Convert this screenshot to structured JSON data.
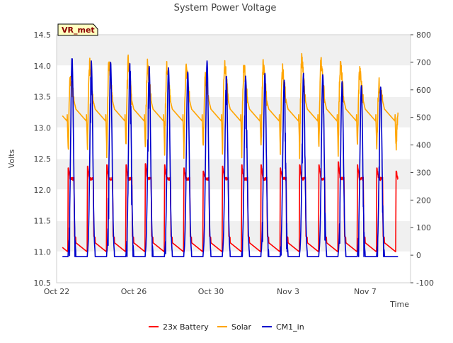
{
  "chart_data": {
    "type": "line",
    "title": "System Power Voltage",
    "xlabel": "Time",
    "ylabel": "Volts",
    "badge": "VR_met",
    "x_ticks": [
      {
        "value": 22,
        "label": "Oct 22"
      },
      {
        "value": 26,
        "label": "Oct 26"
      },
      {
        "value": 30,
        "label": "Oct 30"
      },
      {
        "value": 34,
        "label": "Nov 3"
      },
      {
        "value": 38,
        "label": "Nov 7"
      }
    ],
    "xlim": [
      22,
      40.35
    ],
    "ylim_left": [
      10.5,
      14.5
    ],
    "yticks_left": [
      10.5,
      11.0,
      11.5,
      12.0,
      12.5,
      13.0,
      13.5,
      14.0,
      14.5
    ],
    "ylim_right": [
      -100,
      800
    ],
    "yticks_right": [
      -100,
      0,
      100,
      200,
      300,
      400,
      500,
      600,
      700,
      800
    ],
    "grid_bands": true,
    "legend_placement": "bottom-center",
    "x_start": 22.3,
    "x_end": 39.7,
    "series": [
      {
        "name": "23x Battery",
        "axis": "left",
        "color": "#ff0000",
        "peaks": [
          {
            "day": 22.6,
            "value": 12.35
          },
          {
            "day": 23.6,
            "value": 12.38
          },
          {
            "day": 24.6,
            "value": 12.4
          },
          {
            "day": 25.6,
            "value": 12.4
          },
          {
            "day": 26.6,
            "value": 12.42
          },
          {
            "day": 27.6,
            "value": 12.4
          },
          {
            "day": 28.6,
            "value": 12.35
          },
          {
            "day": 29.6,
            "value": 12.3
          },
          {
            "day": 30.6,
            "value": 12.38
          },
          {
            "day": 31.6,
            "value": 12.4
          },
          {
            "day": 32.6,
            "value": 12.4
          },
          {
            "day": 33.6,
            "value": 12.35
          },
          {
            "day": 34.6,
            "value": 12.4
          },
          {
            "day": 35.6,
            "value": 12.4
          },
          {
            "day": 36.6,
            "value": 12.45
          },
          {
            "day": 37.6,
            "value": 12.4
          },
          {
            "day": 38.6,
            "value": 12.35
          },
          {
            "day": 39.6,
            "value": 12.3
          }
        ],
        "plateau": 12.2,
        "night_start": 11.25,
        "night_end": 11.0
      },
      {
        "name": "Solar",
        "axis": "right",
        "color": "#ffa500",
        "peaks": [
          {
            "day": 22.75,
            "value": 640
          },
          {
            "day": 23.75,
            "value": 690
          },
          {
            "day": 24.75,
            "value": 695
          },
          {
            "day": 25.75,
            "value": 700
          },
          {
            "day": 26.75,
            "value": 690
          },
          {
            "day": 27.75,
            "value": 680
          },
          {
            "day": 28.75,
            "value": 680
          },
          {
            "day": 29.75,
            "value": 640
          },
          {
            "day": 30.75,
            "value": 700
          },
          {
            "day": 31.75,
            "value": 690
          },
          {
            "day": 32.75,
            "value": 690
          },
          {
            "day": 33.75,
            "value": 670
          },
          {
            "day": 34.75,
            "value": 710
          },
          {
            "day": 35.75,
            "value": 705
          },
          {
            "day": 36.75,
            "value": 695
          },
          {
            "day": 37.75,
            "value": 670
          },
          {
            "day": 38.75,
            "value": 620
          }
        ],
        "night_level": 510,
        "min_level": 380
      },
      {
        "name": "CM1_in",
        "axis": "right",
        "color": "#0000cc",
        "peaks": [
          {
            "day": 22.8,
            "value": 720
          },
          {
            "day": 23.8,
            "value": 705
          },
          {
            "day": 24.8,
            "value": 700
          },
          {
            "day": 25.8,
            "value": 695
          },
          {
            "day": 26.8,
            "value": 685
          },
          {
            "day": 27.8,
            "value": 680
          },
          {
            "day": 28.8,
            "value": 665
          },
          {
            "day": 29.8,
            "value": 705
          },
          {
            "day": 30.8,
            "value": 655
          },
          {
            "day": 31.8,
            "value": 650
          },
          {
            "day": 32.8,
            "value": 660
          },
          {
            "day": 33.8,
            "value": 635
          },
          {
            "day": 34.8,
            "value": 660
          },
          {
            "day": 35.8,
            "value": 655
          },
          {
            "day": 36.8,
            "value": 630
          },
          {
            "day": 37.8,
            "value": 615
          },
          {
            "day": 38.8,
            "value": 610
          }
        ],
        "base": -5
      }
    ]
  }
}
